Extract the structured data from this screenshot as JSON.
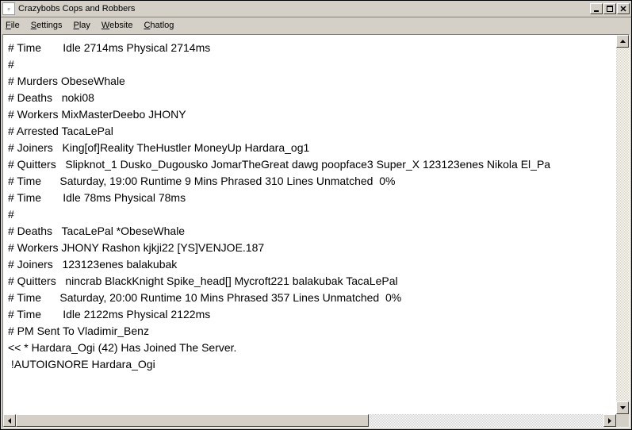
{
  "window": {
    "title": "Crazybobs Cops and Robbers"
  },
  "menu": {
    "file": "File",
    "settings": "Settings",
    "play": "Play",
    "website": "Website",
    "chatlog": "Chatlog"
  },
  "log": {
    "lines": [
      "# Time       Idle 2714ms Physical 2714ms",
      "#",
      "# Murders ObeseWhale",
      "# Deaths   noki08",
      "# Workers MixMasterDeebo JHONY",
      "# Arrested TacaLePal",
      "# Joiners   King[of]Reality TheHustler MoneyUp Hardara_og1",
      "# Quitters   Slipknot_1 Dusko_Dugousko JomarTheGreat dawg poopface3 Super_X 123123enes Nikola El_Pa",
      "# Time      Saturday, 19:00 Runtime 9 Mins Phrased 310 Lines Unmatched  0%",
      "# Time       Idle 78ms Physical 78ms",
      "#",
      "# Deaths   TacaLePal *ObeseWhale",
      "# Workers JHONY Rashon kjkji22 [YS]VENJOE.187",
      "# Joiners   123123enes balakubak",
      "# Quitters   nincrab BlackKnight Spike_head[] Mycroft221 balakubak TacaLePal",
      "# Time      Saturday, 20:00 Runtime 10 Mins Phrased 357 Lines Unmatched  0%",
      "# Time       Idle 2122ms Physical 2122ms",
      "# PM Sent To Vladimir_Benz",
      "<< * Hardara_Ogi (42) Has Joined The Server.",
      " !AUTOIGNORE Hardara_Ogi"
    ]
  }
}
